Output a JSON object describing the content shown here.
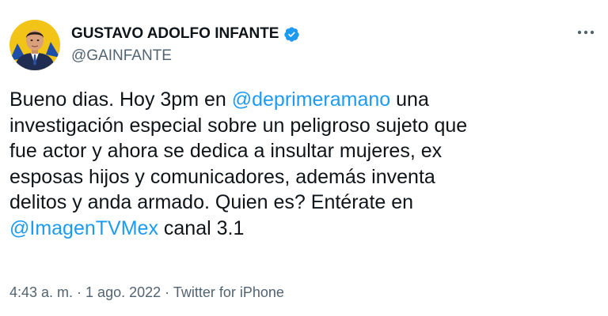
{
  "author": {
    "display_name": "GUSTAVO ADOLFO INFANTE",
    "handle": "@GAINFANTE",
    "verified": true
  },
  "tweet": {
    "lines": [
      [
        {
          "t": "Bueno dias. Hoy  3pm en ",
          "m": false
        },
        {
          "t": "@deprimeramano",
          "m": true
        },
        {
          "t": " una",
          "m": false
        }
      ],
      [
        {
          "t": "investigación especial sobre un peligroso sujeto que",
          "m": false
        }
      ],
      [
        {
          "t": "fue actor y ahora se dedica a insultar mujeres, ex",
          "m": false
        }
      ],
      [
        {
          "t": "esposas  hijos y comunicadores, además inventa",
          "m": false
        }
      ],
      [
        {
          "t": "delitos y anda armado. Quien es? Entérate en",
          "m": false
        }
      ],
      [
        {
          "t": "@ImagenTVMex",
          "m": true
        },
        {
          "t": " canal 3.1",
          "m": false
        }
      ]
    ]
  },
  "meta": {
    "time": "4:43 a. m.",
    "date": "1 ago. 2022",
    "source": "Twitter for iPhone",
    "separator": " · "
  },
  "colors": {
    "mention": "#1d9bf0",
    "verified": "#1d9bf0",
    "avatar_background": "#f2c417"
  },
  "icons": {
    "more": "ellipsis-icon",
    "verified": "verified-badge-icon"
  }
}
